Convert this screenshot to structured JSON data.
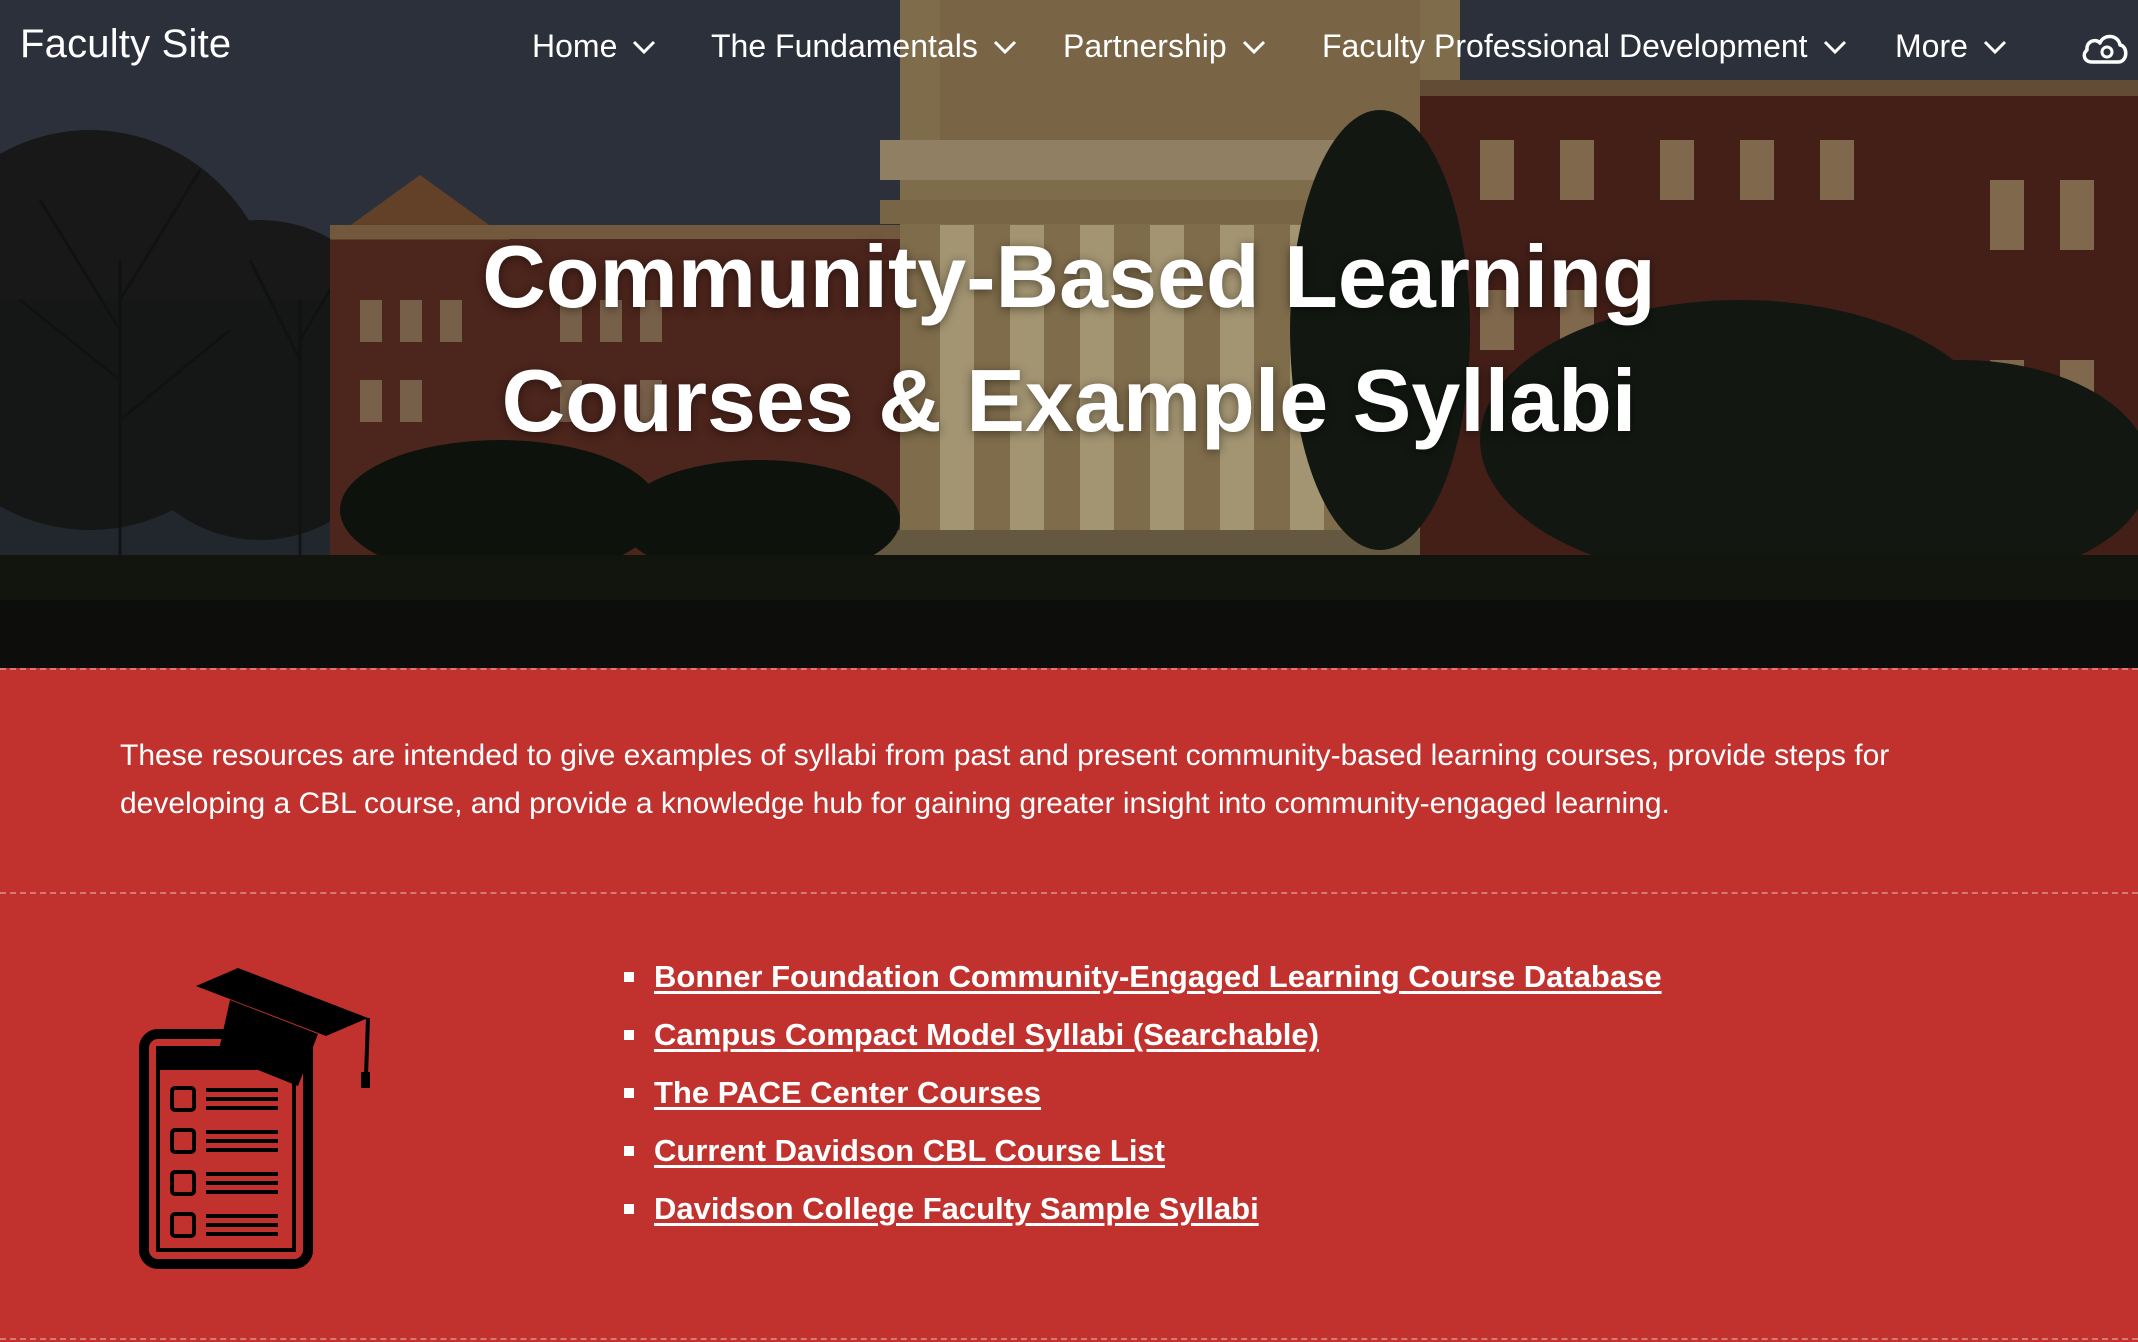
{
  "site": {
    "title": "Faculty Site"
  },
  "nav": {
    "items": [
      {
        "label": "Home"
      },
      {
        "label": "The Fundamentals"
      },
      {
        "label": "Partnership"
      },
      {
        "label": "Faculty Professional Development"
      },
      {
        "label": "More"
      }
    ],
    "right_icon": "cloud-icon"
  },
  "hero": {
    "title_line1": "Community-Based Learning",
    "title_line2": "Courses & Example Syllabi",
    "background": "campus-building-night-photo"
  },
  "intro": {
    "text": "These resources are intended to give examples of syllabi from past and present community-based learning courses, provide steps for developing a CBL course, and provide a knowledge hub for gaining greater insight into community-engaged learning."
  },
  "resources": {
    "icon": "syllabus-graduation-cap-icon",
    "links": [
      {
        "label": "Bonner Foundation Community-Engaged Learning Course Database"
      },
      {
        "label": "Campus Compact Model Syllabi (Searchable) "
      },
      {
        "label": "The PACE Center Courses"
      },
      {
        "label": "Current Davidson CBL Course List"
      },
      {
        "label": "Davidson College Faculty Sample Syllabi"
      }
    ]
  },
  "colors": {
    "section_red": "#c1322e",
    "text_white": "#ffffff",
    "icon_black": "#000000"
  }
}
